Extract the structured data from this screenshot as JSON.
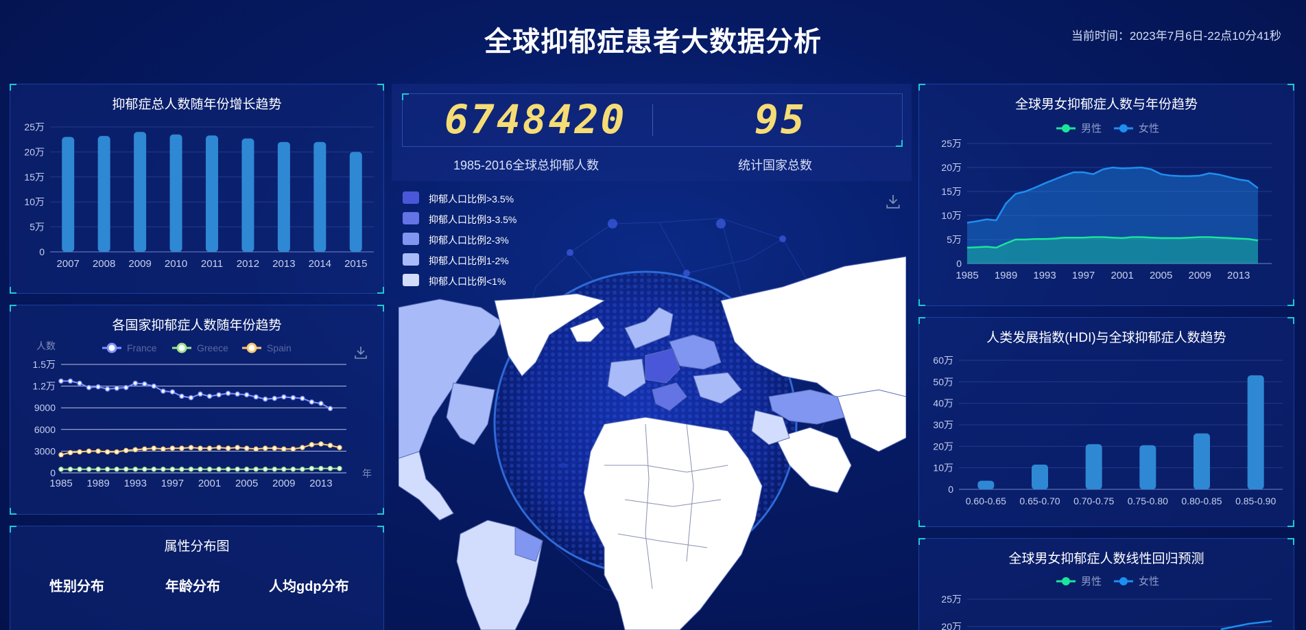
{
  "header": {
    "title": "全球抑郁症患者大数据分析",
    "clock": "当前时间：2023年7月6日-22点10分41秒"
  },
  "kpi": {
    "total_value": "6748420",
    "total_label": "1985-2016全球总抑郁人数",
    "countries_value": "95",
    "countries_label": "统计国家总数"
  },
  "map": {
    "legend": [
      {
        "label": "抑郁人口比例>3.5%",
        "color": "#4a57d8"
      },
      {
        "label": "抑郁人口比例3-3.5%",
        "color": "#6474e4"
      },
      {
        "label": "抑郁人口比例2-3%",
        "color": "#8196f0"
      },
      {
        "label": "抑郁人口比例1-2%",
        "color": "#a8baf8"
      },
      {
        "label": "抑郁人口比例<1%",
        "color": "#d2dcfd"
      }
    ],
    "download_icon": "download-icon"
  },
  "panels": {
    "total_trend": {
      "title": "抑郁症总人数随年份增长趋势"
    },
    "country_trend": {
      "title": "各国家抑郁症人数随年份趋势"
    },
    "attributes": {
      "title": "属性分布图",
      "tabs": [
        "性别分布",
        "年龄分布",
        "人均gdp分布"
      ]
    },
    "gender_trend": {
      "title": "全球男女抑郁症人数与年份趋势"
    },
    "hdi": {
      "title": "人类发展指数(HDI)与全球抑郁症人数趋势"
    },
    "regression": {
      "title": "全球男女抑郁症人数线性回归预测"
    }
  },
  "chart_data": [
    {
      "id": "total",
      "type": "bar",
      "categories": [
        "2007",
        "2008",
        "2009",
        "2010",
        "2011",
        "2012",
        "2013",
        "2014",
        "2015"
      ],
      "values": [
        230000,
        232000,
        240000,
        235000,
        233000,
        227000,
        220000,
        220000,
        200000
      ],
      "ylim": [
        0,
        250000
      ],
      "yticks": [
        "0",
        "5万",
        "10万",
        "15万",
        "20万",
        "25万"
      ],
      "colors": {
        "bar": "#2f88d3"
      }
    },
    {
      "id": "country",
      "type": "line",
      "ylabel": "人数",
      "xlabel": "年",
      "xticks": [
        "1985",
        "1989",
        "1993",
        "1997",
        "2001",
        "2005",
        "2009",
        "2013"
      ],
      "x": [
        1985,
        1986,
        1987,
        1988,
        1989,
        1990,
        1991,
        1992,
        1993,
        1994,
        1995,
        1996,
        1997,
        1998,
        1999,
        2000,
        2001,
        2002,
        2003,
        2004,
        2005,
        2006,
        2007,
        2008,
        2009,
        2010,
        2011,
        2012,
        2013,
        2014,
        2015
      ],
      "ylim": [
        0,
        15000
      ],
      "yticks": [
        "0",
        "3000",
        "6000",
        "9000",
        "1.2万",
        "1.5万"
      ],
      "series": [
        {
          "name": "France",
          "color": "#7f93ff",
          "values": [
            12700,
            12700,
            12400,
            11800,
            11900,
            11600,
            11700,
            11800,
            12400,
            12300,
            12000,
            11300,
            11200,
            10600,
            10400,
            10900,
            10600,
            10800,
            11000,
            10900,
            10800,
            10500,
            10200,
            10300,
            10500,
            10400,
            10300,
            9800,
            9600,
            8900,
            null
          ]
        },
        {
          "name": "Greece",
          "color": "#9be48c",
          "values": [
            500,
            500,
            500,
            500,
            500,
            500,
            500,
            500,
            500,
            500,
            500,
            500,
            500,
            500,
            500,
            500,
            500,
            500,
            500,
            500,
            500,
            500,
            500,
            500,
            500,
            500,
            500,
            600,
            600,
            600,
            600
          ]
        },
        {
          "name": "Spain",
          "color": "#ffc86a",
          "values": [
            2500,
            2800,
            2900,
            3000,
            3000,
            2900,
            2900,
            3100,
            3200,
            3300,
            3400,
            3300,
            3400,
            3400,
            3500,
            3400,
            3400,
            3500,
            3400,
            3500,
            3400,
            3300,
            3400,
            3400,
            3300,
            3300,
            3500,
            3900,
            4000,
            3800,
            3500
          ]
        }
      ]
    },
    {
      "id": "gender",
      "type": "area",
      "xticks": [
        "1985",
        "1989",
        "1993",
        "1997",
        "2001",
        "2005",
        "2009",
        "2013"
      ],
      "x": [
        1985,
        1986,
        1987,
        1988,
        1989,
        1990,
        1991,
        1992,
        1993,
        1994,
        1995,
        1996,
        1997,
        1998,
        1999,
        2000,
        2001,
        2002,
        2003,
        2004,
        2005,
        2006,
        2007,
        2008,
        2009,
        2010,
        2011,
        2012,
        2013,
        2014,
        2015
      ],
      "ylim": [
        0,
        250000
      ],
      "yticks": [
        "0",
        "5万",
        "10万",
        "15万",
        "20万",
        "25万"
      ],
      "series": [
        {
          "name": "男性",
          "color": "#1be59a",
          "values": [
            33000,
            34000,
            35000,
            33000,
            42000,
            50000,
            50000,
            51000,
            51000,
            52000,
            54000,
            54000,
            54000,
            55000,
            55000,
            54000,
            53000,
            55000,
            55000,
            54000,
            53000,
            53000,
            53000,
            54000,
            55000,
            55000,
            54000,
            53000,
            52000,
            51000,
            48000
          ]
        },
        {
          "name": "女性",
          "color": "#1e8ef0",
          "values": [
            85000,
            88000,
            92000,
            90000,
            125000,
            145000,
            150000,
            158000,
            167000,
            175000,
            183000,
            190000,
            190000,
            186000,
            196000,
            200000,
            198000,
            199000,
            200000,
            196000,
            186000,
            183000,
            182000,
            182000,
            183000,
            188000,
            185000,
            180000,
            175000,
            172000,
            157000
          ]
        }
      ]
    },
    {
      "id": "hdi",
      "type": "bar",
      "categories": [
        "0.60-0.65",
        "0.65-0.70",
        "0.70-0.75",
        "0.75-0.80",
        "0.80-0.85",
        "0.85-0.90"
      ],
      "values": [
        40000,
        115000,
        210000,
        205000,
        260000,
        530000
      ],
      "ylim": [
        0,
        600000
      ],
      "yticks": [
        "0",
        "10万",
        "20万",
        "30万",
        "40万",
        "50万",
        "60万"
      ],
      "colors": {
        "bar": "#2f88d3"
      }
    },
    {
      "id": "regression",
      "type": "line",
      "yticks_visible": [
        "20万",
        "25万"
      ],
      "series": [
        {
          "name": "男性",
          "color": "#1be59a"
        },
        {
          "name": "女性",
          "color": "#1e8ef0"
        }
      ]
    }
  ]
}
